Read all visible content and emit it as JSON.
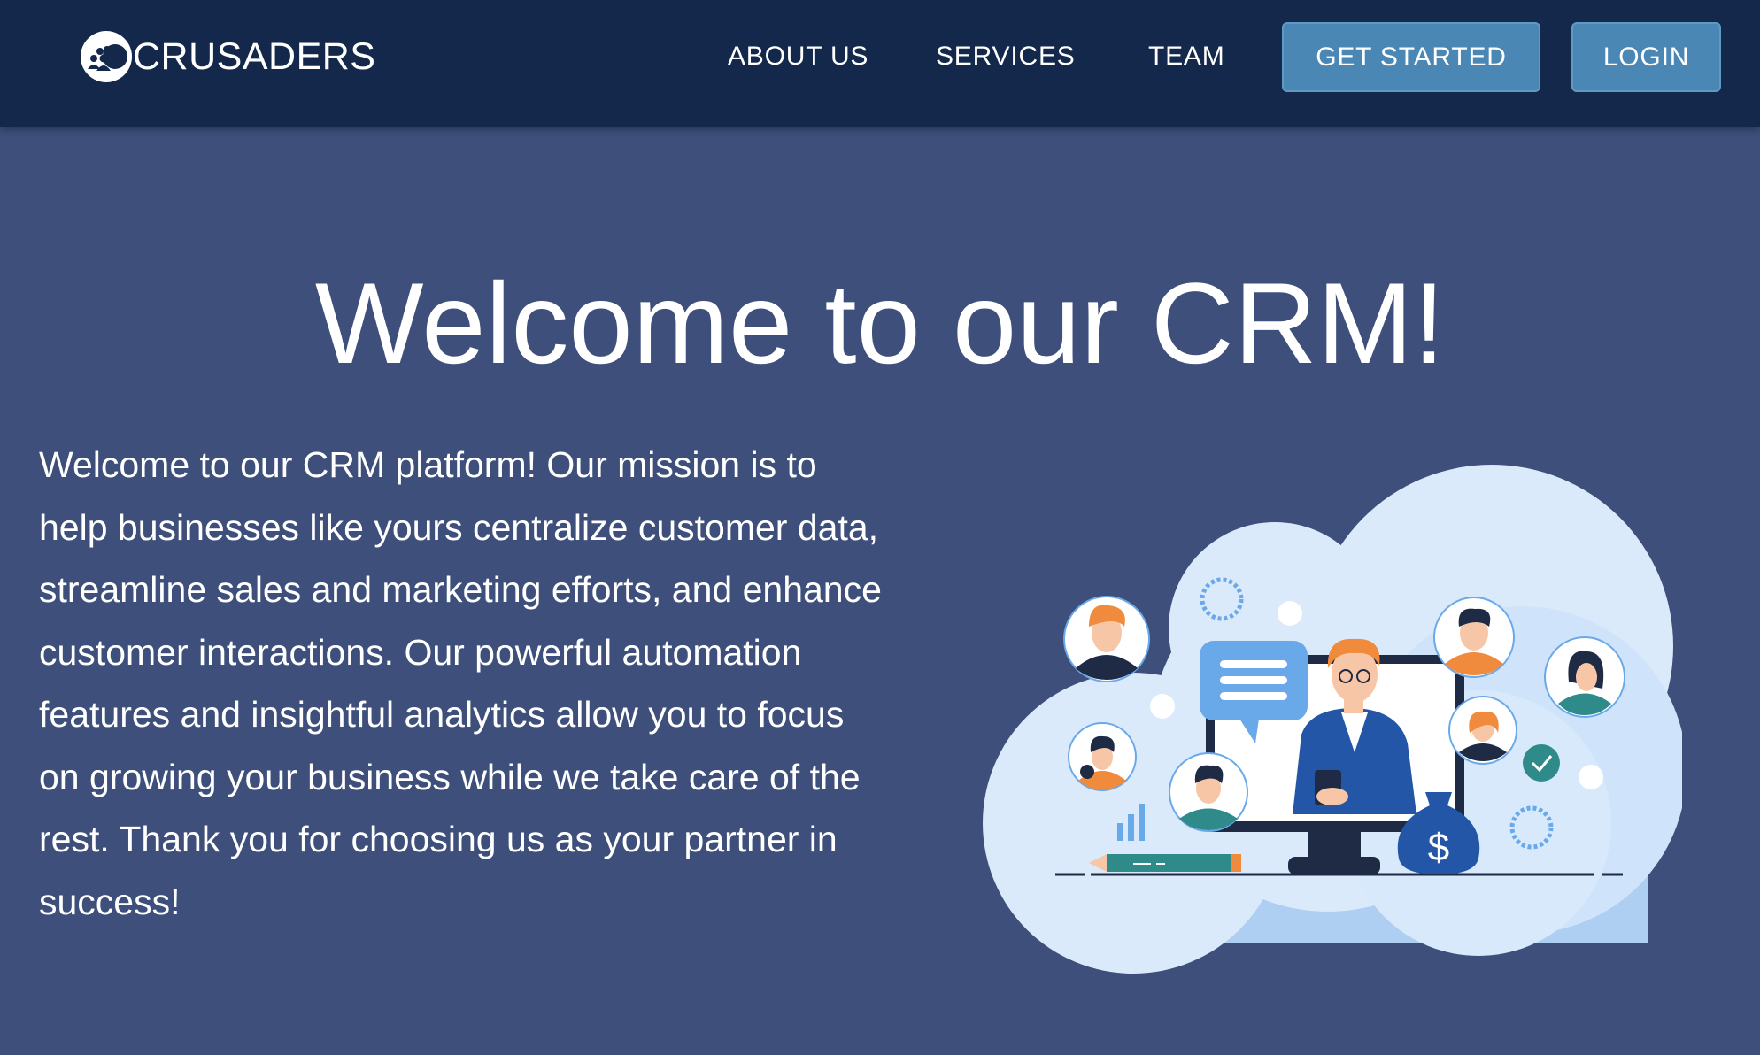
{
  "nav": {
    "brand": "CRUSADERS",
    "links": [
      "ABOUT US",
      "SERVICES",
      "TEAM"
    ],
    "get_started": "GET STARTED",
    "login": "LOGIN"
  },
  "hero": {
    "title": "Welcome to our CRM!",
    "body": "Welcome to our CRM platform! Our mission is to help businesses like yours centralize customer data, streamline sales and marketing efforts, and enhance customer interactions. Our powerful automation features and insightful analytics allow you to focus on growing your business while we take care of the rest. Thank you for choosing us as your partner in success!",
    "illustration_currency": "$"
  },
  "colors": {
    "navbar": "#13284a",
    "page_bg": "#3d4f7a",
    "button": "#4a87b5",
    "illustration_light": "#dbeafb",
    "accent_orange": "#f08a3c",
    "accent_blue": "#2456a8"
  },
  "icons": [
    "crusaders-logo-icon",
    "chat-bubble-icon",
    "gear-icon",
    "money-bag-icon",
    "checkmark-icon",
    "pencil-icon"
  ]
}
